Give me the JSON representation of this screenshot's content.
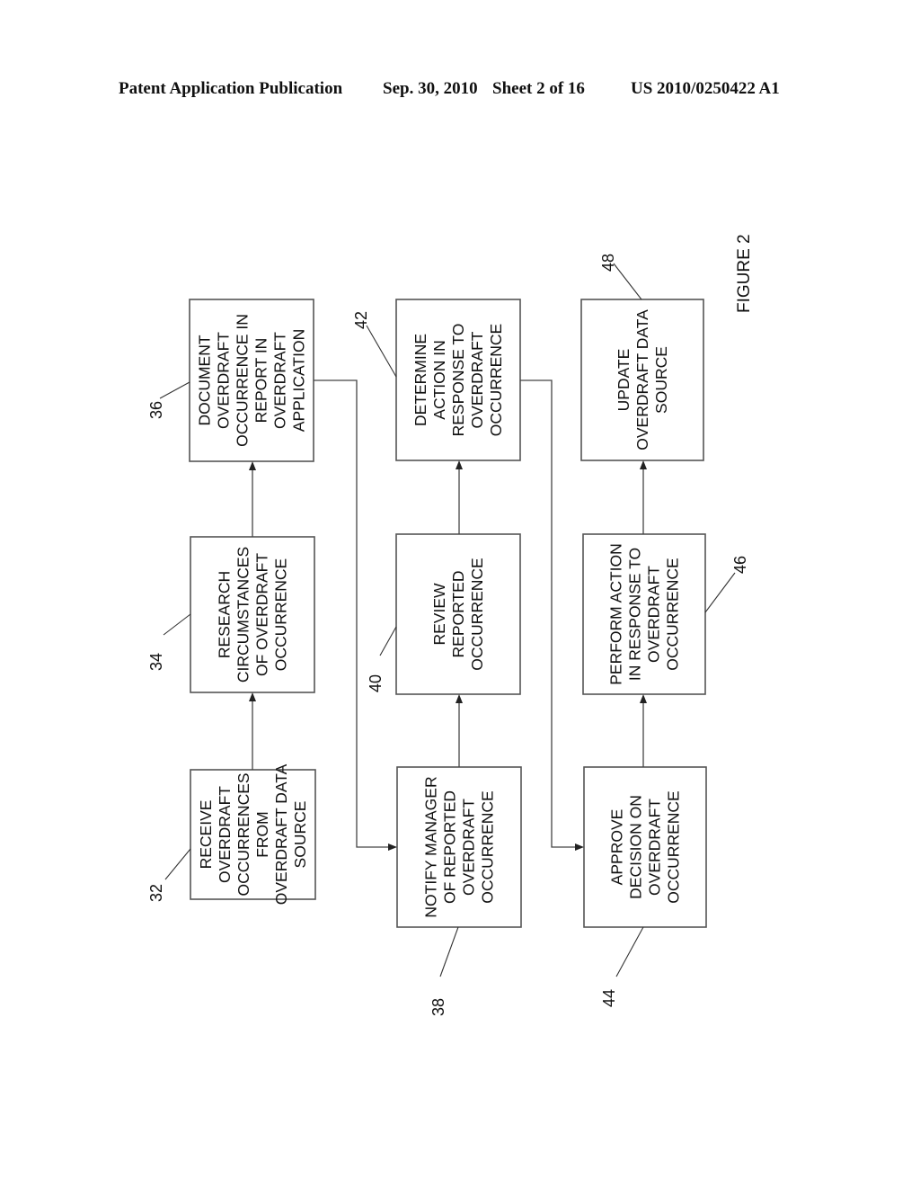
{
  "header": {
    "publication_type": "Patent Application Publication",
    "date": "Sep. 30, 2010",
    "sheet": "Sheet 2 of 16",
    "publication_number": "US 2010/0250422 A1"
  },
  "figure": {
    "label": "FIGURE 2",
    "orientation": "rotated 90° counter-clockwise"
  },
  "steps": [
    {
      "ref": "32",
      "lines": [
        "RECEIVE",
        "OVERDRAFT",
        "OCCURRENCES",
        "FROM",
        "OVERDRAFT DATA",
        "SOURCE"
      ]
    },
    {
      "ref": "34",
      "lines": [
        "RESEARCH",
        "CIRCUMSTANCES",
        "OF OVERDRAFT",
        "OCCURRENCE"
      ]
    },
    {
      "ref": "36",
      "lines": [
        "DOCUMENT",
        "OVERDRAFT",
        "OCCURRENCE IN",
        "REPORT IN",
        "OVERDRAFT",
        "APPLICATION"
      ]
    },
    {
      "ref": "38",
      "lines": [
        "NOTIFY MANAGER",
        "OF REPORTED",
        "OVERDRAFT",
        "OCCURRENCE"
      ]
    },
    {
      "ref": "40",
      "lines": [
        "REVIEW",
        "REPORTED",
        "OCCURRENCE"
      ]
    },
    {
      "ref": "42",
      "lines": [
        "DETERMINE",
        "ACTION IN",
        "RESPONSE TO",
        "OVERDRAFT",
        "OCCURRENCE"
      ]
    },
    {
      "ref": "44",
      "lines": [
        "APPROVE",
        "DECISION ON",
        "OVERDRAFT",
        "OCCURRENCE"
      ]
    },
    {
      "ref": "46",
      "lines": [
        "PERFORM ACTION",
        "IN RESPONSE TO",
        "OVERDRAFT",
        "OCCURRENCE"
      ]
    },
    {
      "ref": "48",
      "lines": [
        "UPDATE",
        "OVERDRAFT DATA",
        "SOURCE"
      ]
    }
  ],
  "flow": [
    [
      "32",
      "34"
    ],
    [
      "34",
      "36"
    ],
    [
      "36",
      "38"
    ],
    [
      "38",
      "40"
    ],
    [
      "40",
      "42"
    ],
    [
      "42",
      "44"
    ],
    [
      "44",
      "46"
    ],
    [
      "46",
      "48"
    ]
  ]
}
